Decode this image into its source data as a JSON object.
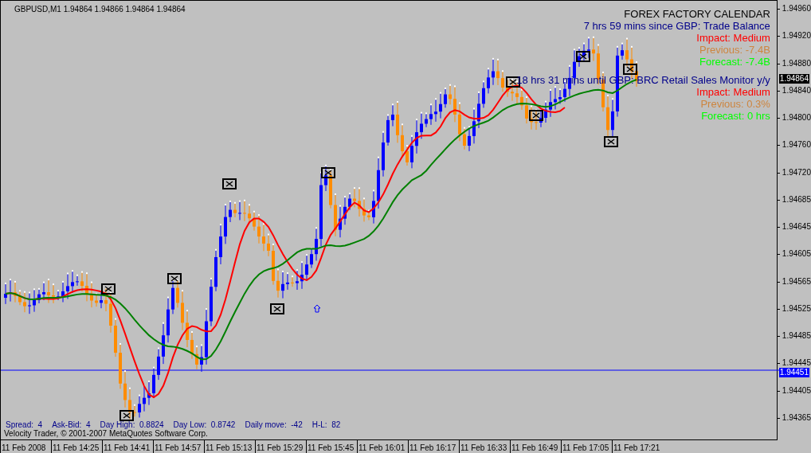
{
  "symbol_header": "GBPUSD,M1  1.94864 1.94866 1.94864 1.94864",
  "calendar": {
    "title": "FOREX FACTORY CALENDAR",
    "events": [
      {
        "headline": "7 hrs 59 mins since GBP: Trade Balance",
        "impact": "Impact: Medium",
        "previous": "Previous: -7.4B",
        "forecast": "Forecast: -7.4B"
      },
      {
        "headline": "18 hrs 31 mins until GBP: BRC Retail Sales Monitor y/y",
        "impact": "Impact: Medium",
        "previous": "Previous: 0.3%",
        "forecast": "Forecast: 0 hrs"
      }
    ]
  },
  "info_bar": [
    {
      "label": "Spread:",
      "value": "4"
    },
    {
      "label": "Ask-Bid:",
      "value": "4"
    },
    {
      "label": "Day High:",
      "value": "0.8824"
    },
    {
      "label": "Day Low:",
      "value": "0.8742"
    },
    {
      "label": "Daily move:",
      "value": "-42"
    },
    {
      "label": "H-L:",
      "value": "82"
    }
  ],
  "copyright": "Velocity Trader, © 2001-2007 MetaQuotes Software Corp.",
  "price_axis": {
    "ticks": [
      "1.94960",
      "1.94920",
      "1.94880",
      "1.94840",
      "1.94800",
      "1.94760",
      "1.94720",
      "1.94685",
      "1.94645",
      "1.94605",
      "1.94565",
      "1.94525",
      "1.94485",
      "1.94445",
      "1.94405",
      "1.94365"
    ],
    "current_price": "1.94864",
    "line_price": "1.94451"
  },
  "time_axis": [
    "11 Feb 2008",
    "11 Feb 14:25",
    "11 Feb 14:41",
    "11 Feb 14:57",
    "11 Feb 15:13",
    "11 Feb 15:29",
    "11 Feb 15:45",
    "11 Feb 16:01",
    "11 Feb 16:17",
    "11 Feb 16:33",
    "11 Feb 16:49",
    "11 Feb 17:05",
    "11 Feb 17:21"
  ]
}
